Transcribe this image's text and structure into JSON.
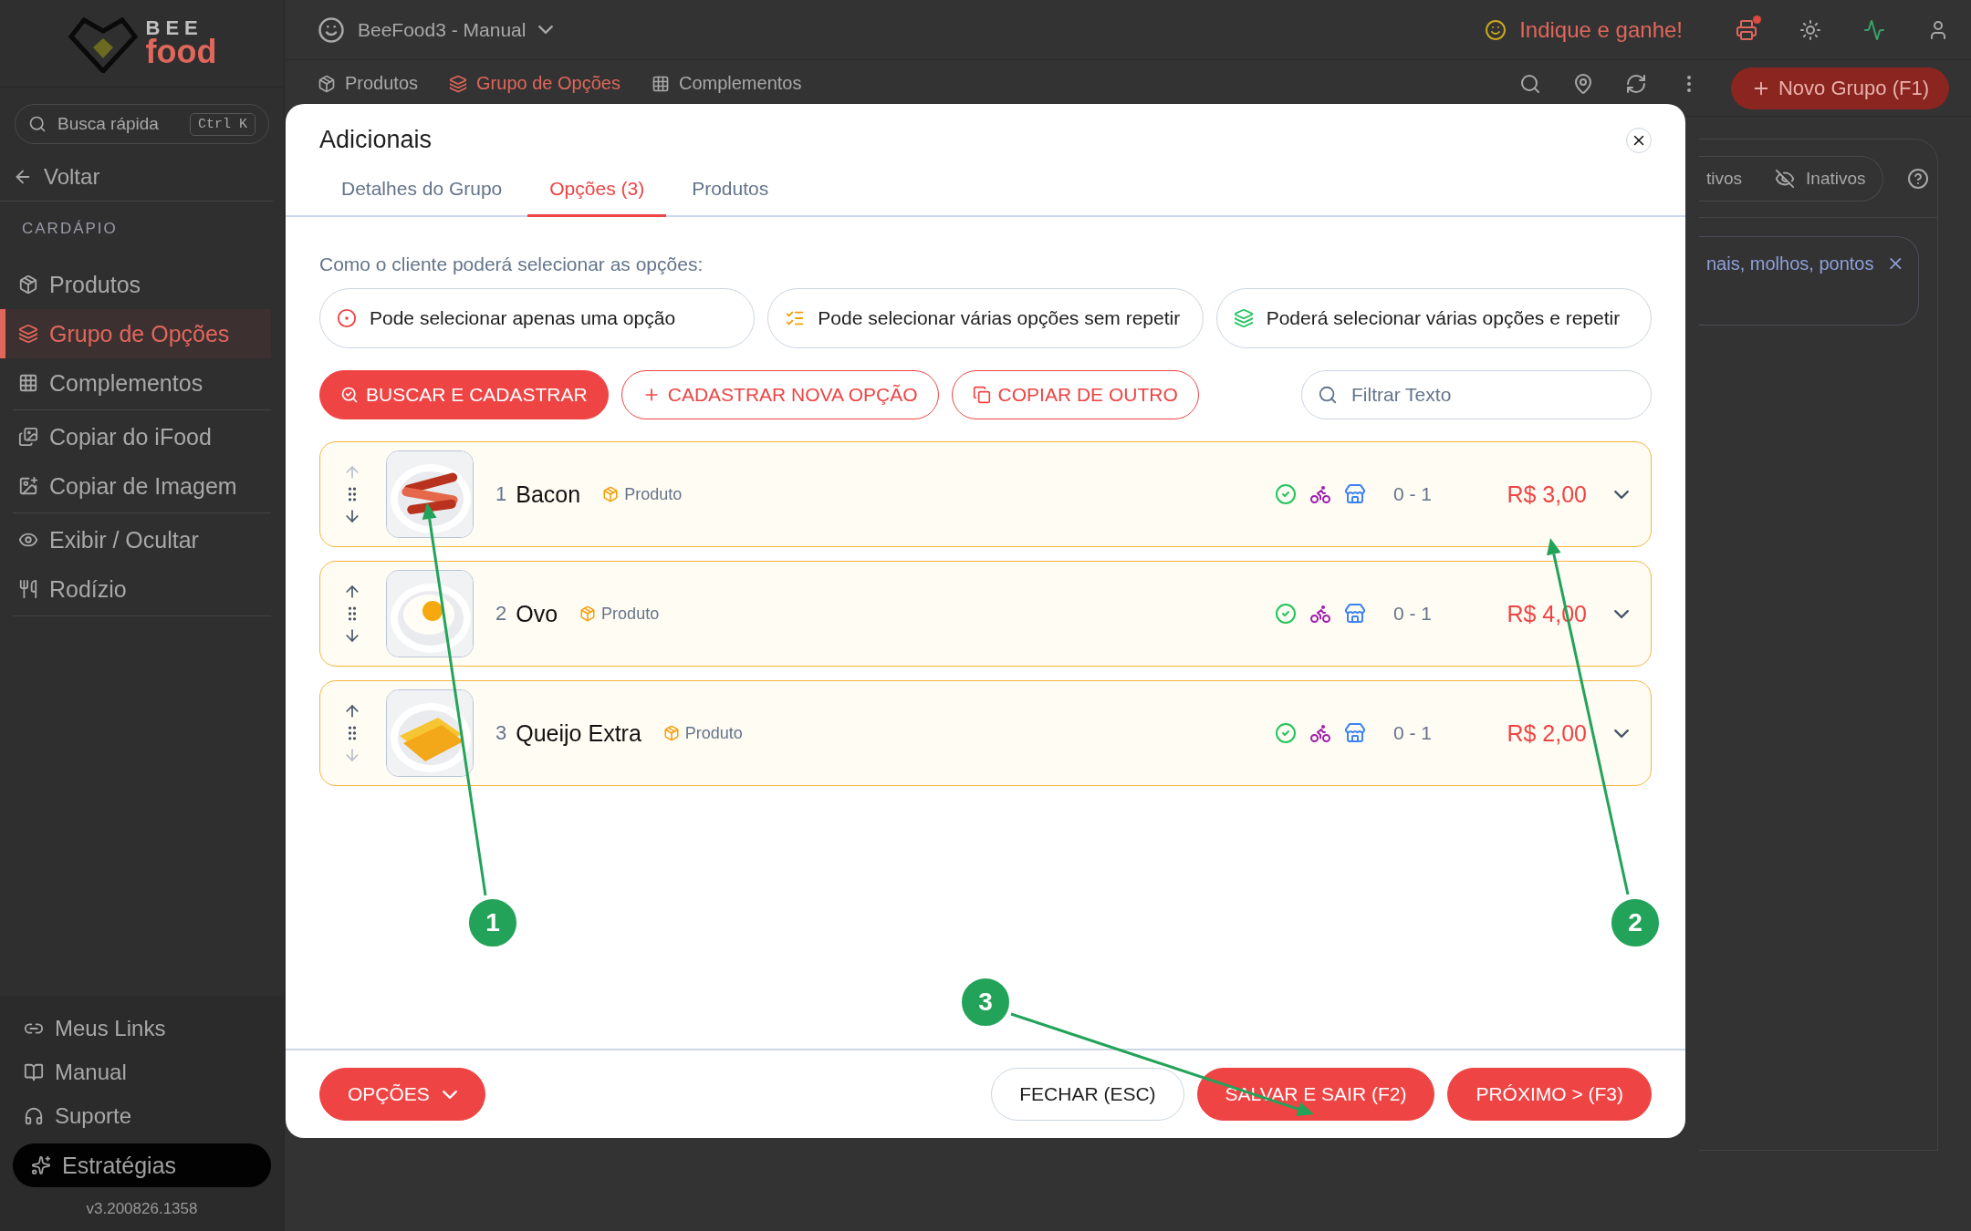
{
  "sidebar": {
    "logo": {
      "top": "BEE",
      "bottom": "food"
    },
    "search": {
      "placeholder": "Busca rápida",
      "shortcut": "Ctrl K"
    },
    "back": "Voltar",
    "section": "CARDÁPIO",
    "groups": [
      [
        {
          "label": "Produtos",
          "selected": false
        },
        {
          "label": "Grupo de Opções",
          "selected": true
        },
        {
          "label": "Complementos",
          "selected": false
        }
      ],
      [
        {
          "label": "Copiar do iFood",
          "selected": false
        },
        {
          "label": "Copiar de Imagem",
          "selected": false
        }
      ],
      [
        {
          "label": "Exibir / Ocultar",
          "selected": false
        },
        {
          "label": "Rodízio",
          "selected": false
        }
      ]
    ],
    "footer_items": [
      "Meus Links",
      "Manual",
      "Suporte"
    ],
    "strategies": "Estratégias",
    "version": "v3.200826.1358"
  },
  "topbar": {
    "store": "BeeFood3 - Manual",
    "referral": "Indique e ganhe!",
    "notification": true
  },
  "page_tabs": [
    {
      "label": "Produtos",
      "selected": false
    },
    {
      "label": "Grupo de Opções",
      "selected": true
    },
    {
      "label": "Complementos",
      "selected": false
    }
  ],
  "new_button": "Novo Grupo (F1)",
  "filters": [
    "tivos",
    "Inativos"
  ],
  "info_text": "nais, molhos, pontos",
  "modal": {
    "title": "Adicionais",
    "tabs": [
      {
        "label": "Detalhes do Grupo",
        "selected": false
      },
      {
        "label": "Opções (3)",
        "selected": true
      },
      {
        "label": "Produtos",
        "selected": false
      }
    ],
    "prompt": "Como o cliente poderá selecionar as opções:",
    "modes": [
      "Pode selecionar apenas uma opção",
      "Pode selecionar várias opções sem repetir",
      "Poderá selecionar várias opções e repetir"
    ],
    "actions": [
      {
        "label": "BUSCAR E CADASTRAR",
        "kind": "primary"
      },
      {
        "label": "CADASTRAR NOVA OPÇÃO",
        "kind": "add"
      },
      {
        "label": "COPIAR DE OUTRO",
        "kind": "copy"
      }
    ],
    "filter": {
      "placeholder": "Filtrar Texto"
    },
    "options": [
      {
        "number": "1",
        "name": "Bacon",
        "tag": "Produto",
        "range": "0 - 1",
        "price": "R$ 3,00",
        "up_disabled": true,
        "down_disabled": false
      },
      {
        "number": "2",
        "name": "Ovo",
        "tag": "Produto",
        "range": "0 - 1",
        "price": "R$ 4,00",
        "up_disabled": false,
        "down_disabled": false
      },
      {
        "number": "3",
        "name": "Queijo Extra",
        "tag": "Produto",
        "range": "0 - 1",
        "price": "R$ 2,00",
        "up_disabled": false,
        "down_disabled": true
      }
    ],
    "options_button": "OPÇÕES",
    "buttons": [
      {
        "label": "FECHAR (ESC)",
        "kind": "outline"
      },
      {
        "label": "SALVAR E SAIR (F2)",
        "kind": "primary"
      },
      {
        "label": "PRÓXIMO > (F3)",
        "kind": "primary"
      }
    ]
  },
  "annotations": [
    "1",
    "2",
    "3"
  ]
}
